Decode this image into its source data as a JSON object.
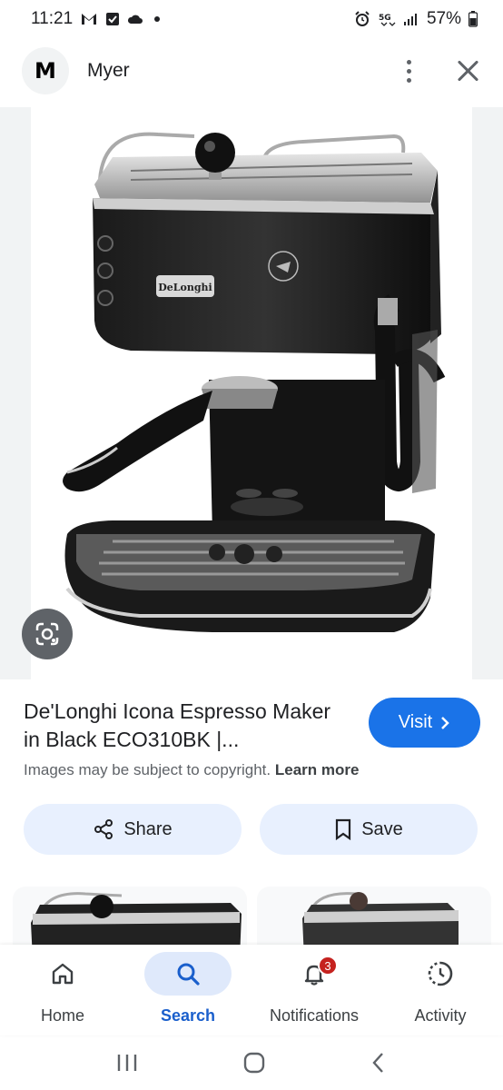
{
  "status_bar": {
    "time": "11:21",
    "left_icons": [
      "gmail-icon",
      "check-box-icon",
      "cloud-icon",
      "dot-icon"
    ],
    "right_icons": [
      "alarm-icon",
      "5g-icon",
      "signal-icon"
    ],
    "battery_text": "57%"
  },
  "top_bar": {
    "logo_letter": "M",
    "site_name": "Myer",
    "more_icon": "more-vert-icon",
    "close_icon": "close-icon"
  },
  "result": {
    "title": "De'Longhi Icona Espresso Maker in Black ECO310BK |...",
    "visit_label": "Visit",
    "copyright_text": "Images may be subject to copyright.",
    "learn_more": "Learn more",
    "share_label": "Share",
    "save_label": "Save"
  },
  "bottom_nav": {
    "items": [
      {
        "label": "Home",
        "icon": "home-icon"
      },
      {
        "label": "Search",
        "icon": "search-icon"
      },
      {
        "label": "Notifications",
        "icon": "bell-icon",
        "badge": "3"
      },
      {
        "label": "Activity",
        "icon": "activity-icon"
      }
    ],
    "active": "Search"
  },
  "colors": {
    "accent": "#1a73e8",
    "pill": "#e8f0fe",
    "badge": "#c5221f"
  }
}
